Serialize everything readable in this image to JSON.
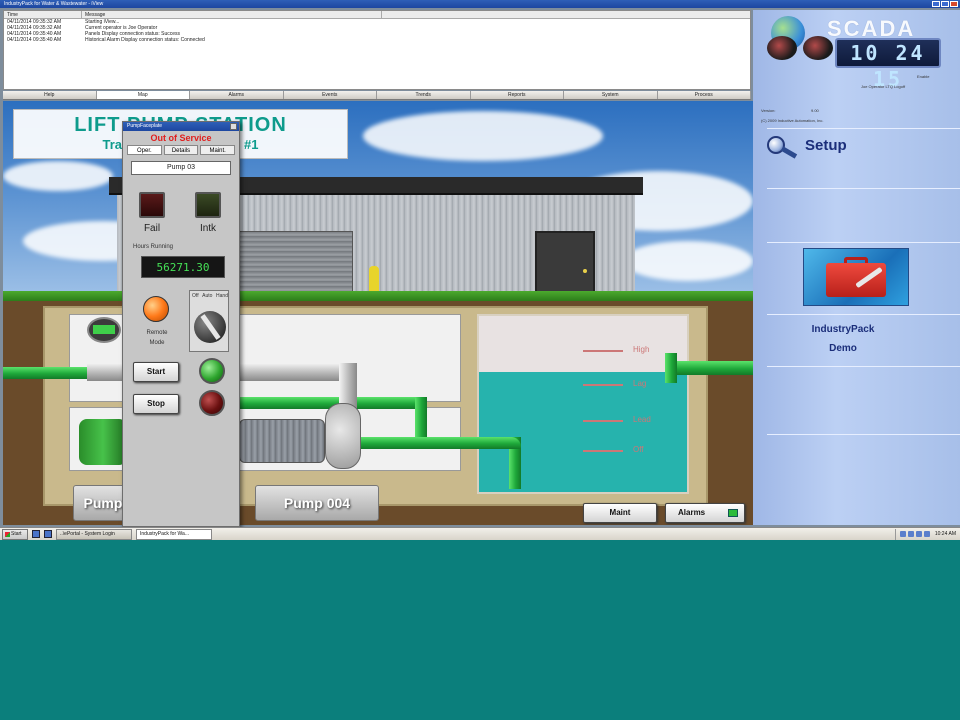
{
  "window": {
    "title": "IndustryPack for Water & Wastewater - iView"
  },
  "log": {
    "columns": [
      "Time",
      "Message"
    ],
    "rows": [
      {
        "time": "04/11/2014 09:35:32 AM",
        "message": "Starting iView..."
      },
      {
        "time": "04/11/2014 09:35:32 AM",
        "message": "Current operator is Joe Operator"
      },
      {
        "time": "04/11/2014 09:35:40 AM",
        "message": "Panels Display connection status: Success"
      },
      {
        "time": "04/11/2014 09:35:40 AM",
        "message": "Historical Alarm Display connection status: Connected"
      }
    ]
  },
  "tabs": [
    "Help",
    "Map",
    "Alarms",
    "Events",
    "Trends",
    "Reports",
    "System",
    "Process"
  ],
  "station": {
    "title": "LIFT PUMP STATION",
    "subtitle": "Trabuco Pump Station #1"
  },
  "wetwell": {
    "levels": [
      "High",
      "Lag",
      "Lead",
      "Off"
    ]
  },
  "buttons": {
    "pump_left": "Pump",
    "pump_004": "Pump 004",
    "maint": "Maint",
    "alarms": "Alarms"
  },
  "faceplate": {
    "title": "PumpFaceplate",
    "status": "Out of Service",
    "tabs": [
      "Oper.",
      "Details",
      "Maint."
    ],
    "pump_name": "Pump 03",
    "fail_label": "Fail",
    "intk_label": "Intk",
    "hours_label": "Hours Running",
    "hours_value": "56271.30",
    "remote_label_1": "Remote",
    "remote_label_2": "Mode",
    "selector_labels": [
      "Off",
      "Auto",
      "Hand"
    ],
    "start_label": "Start",
    "stop_label": "Stop"
  },
  "right_panel": {
    "brand": "SCADA",
    "clock": "10 24 15",
    "user_line1": "Enable",
    "user_line2": "Joe Operator LTQ Logoff",
    "version_label": "Version:",
    "version_value": "9.00",
    "copyright": "(C) 2009 Inductive Automation, Inc.",
    "setup_label": "Setup",
    "industrypack_line1": "IndustryPack",
    "industrypack_line2": "Demo"
  },
  "taskbar": {
    "start": "Start",
    "tasks": [
      "..\\ePortal - System Login",
      "IndustryPack for Wa..."
    ],
    "time": "10:24 AM"
  },
  "colors": {
    "accent": "#0e9b8c",
    "pipe_green": "#1ea83a",
    "water": "#26b3ad",
    "panel_blue": "#a7bfe9",
    "desktop": "#0b7f7c"
  }
}
